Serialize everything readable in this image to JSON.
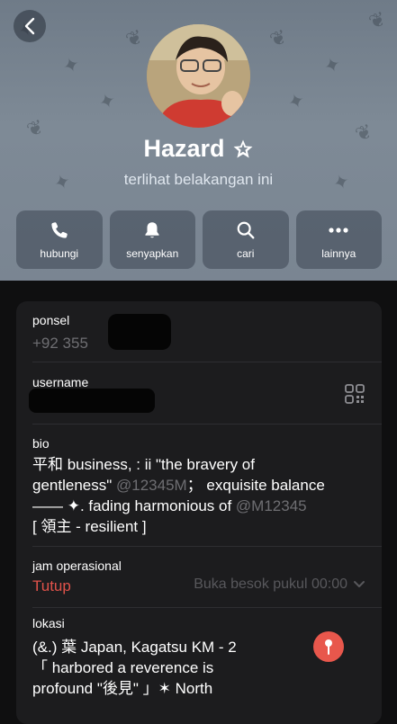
{
  "profile": {
    "name": "Hazard",
    "status": "terlihat belakangan ini"
  },
  "actions": [
    {
      "label": "hubungi",
      "icon": "phone-icon"
    },
    {
      "label": "senyapkan",
      "icon": "bell-icon"
    },
    {
      "label": "cari",
      "icon": "search-icon"
    },
    {
      "label": "lainnya",
      "icon": "more-icon"
    }
  ],
  "info": {
    "phone_label": "ponsel",
    "phone_value": "+92 355",
    "username_label": "username",
    "bio_label": "bio",
    "bio_line1": "平和 business, : ii \"the bravery of",
    "bio_line2a": "gentleness\"",
    "bio_line2b": "@12345M",
    "bio_line2c": "；  exquisite balance",
    "bio_line3a": "—— ✦. fading harmonious of",
    "bio_line3b": "@M12345",
    "bio_line4": "[ 領主 - resilient ]",
    "hours_label": "jam operasional",
    "hours_status": "Tutup",
    "hours_next": "Buka besok pukul 00:00",
    "location_label": "lokasi",
    "location_line1": "(&.) 葉 Japan, Kagatsu KM - 2",
    "location_line2": "「 harbored a reverence is",
    "location_line3": "profound \"後見\" 」✶ North"
  },
  "colors": {
    "header_bg": "#7a8592",
    "card_bg": "#1c1c1e",
    "accent_red": "#e0524a",
    "muted_text": "#6e6e72"
  }
}
